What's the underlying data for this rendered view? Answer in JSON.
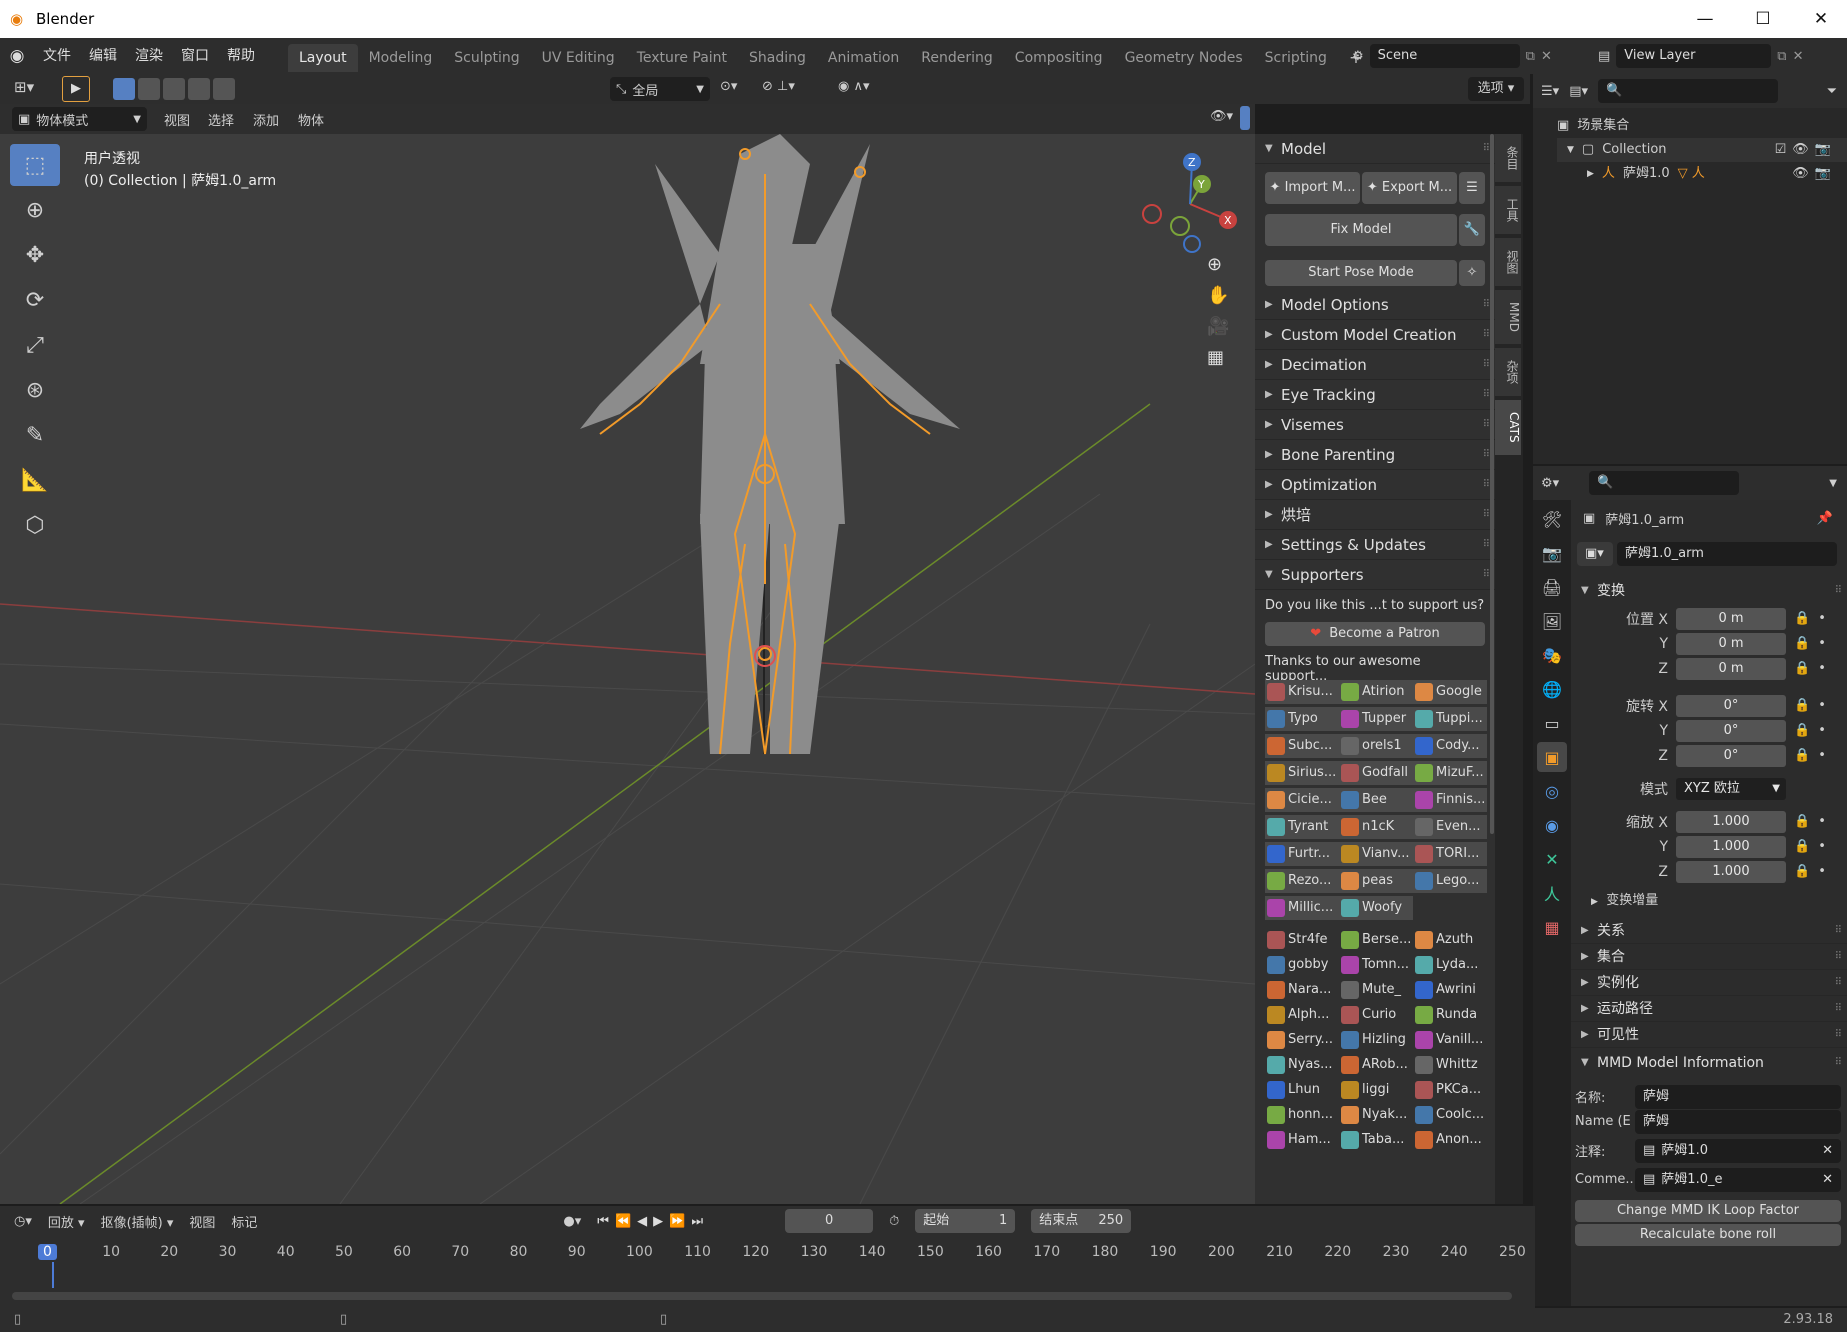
{
  "app": {
    "title": "Blender",
    "version": "2.93.18"
  },
  "menu": {
    "items": [
      "文件",
      "编辑",
      "渲染",
      "窗口",
      "帮助"
    ]
  },
  "workspaces": [
    "Layout",
    "Modeling",
    "Sculpting",
    "UV Editing",
    "Texture Paint",
    "Shading",
    "Animation",
    "Rendering",
    "Compositing",
    "Geometry Nodes",
    "Scripting"
  ],
  "active_workspace": "Layout",
  "scene": {
    "name": "Scene",
    "view_layer": "View Layer"
  },
  "viewport_header": {
    "transform_orientation": "全局",
    "options_label": "选项",
    "mode": "物体模式",
    "menus": [
      "视图",
      "选择",
      "添加",
      "物体"
    ]
  },
  "viewport": {
    "view_name": "用户透视",
    "collection_info": "(0) Collection | 萨姆1.0_arm",
    "gizmo_axes": [
      "X",
      "Y",
      "Z"
    ]
  },
  "cats_panel": {
    "header": "Model",
    "import_label": "Import M...",
    "export_label": "Export M...",
    "fix_label": "Fix Model",
    "pose_label": "Start Pose Mode",
    "sections": [
      "Model Options",
      "Custom Model Creation",
      "Decimation",
      "Eye Tracking",
      "Visemes",
      "Bone Parenting",
      "Optimization",
      "烘培",
      "Settings & Updates"
    ],
    "supporters_header": "Supporters",
    "support_text": "Do you like this ...t to support us?",
    "patron_label": "Become a Patron",
    "thanks_text": "Thanks to our awesome support...",
    "supporters_a": [
      "Krisu...",
      "Atirion",
      "Google",
      "Typo",
      "Tupper",
      "Tuppi...",
      "Subc...",
      "orels1",
      "Cody...",
      "Sirius...",
      "Godfall",
      "MizuF...",
      "Cicie...",
      "Bee",
      "Finnis...",
      "Tyrant",
      "n1cK",
      "Even...",
      "Furtr...",
      "Vianv...",
      "TORI...",
      "Rezo...",
      "peas",
      "Lego...",
      "Millic...",
      "Woofy"
    ],
    "supporters_b": [
      "Str4fe",
      "Berse...",
      "Azuth",
      "gobby",
      "Tomn...",
      "Lyda...",
      "Nara...",
      "Mute_",
      "Awrini",
      "Alph...",
      "Curio",
      "Runda",
      "Serry...",
      "Hizling",
      "Vanill...",
      "Nyas...",
      "ARob...",
      "Whittz",
      "Lhun",
      "liggi",
      "PKCa...",
      "honn...",
      "Nyak...",
      "Coolc...",
      "Ham...",
      "Taba...",
      "Anon..."
    ]
  },
  "vertical_tabs": [
    "条目",
    "工具",
    "视图",
    "MMD",
    "杂项",
    "CATS"
  ],
  "active_vtab": "CATS",
  "outliner": {
    "root": "场景集合",
    "collection": "Collection",
    "object": "萨姆1.0"
  },
  "properties": {
    "object_name": "萨姆1.0_arm",
    "data_name": "萨姆1.0_arm",
    "transform_header": "变换",
    "location_label": "位置 X",
    "rotation_label": "旋转 X",
    "scale_label": "缩放 X",
    "axis_y": "Y",
    "axis_z": "Z",
    "location": [
      "0 m",
      "0 m",
      "0 m"
    ],
    "rotation": [
      "0°",
      "0°",
      "0°"
    ],
    "mode_label": "模式",
    "rotation_mode": "XYZ 欧拉",
    "scale": [
      "1.000",
      "1.000",
      "1.000"
    ],
    "delta_transform": "变换增量",
    "collapsed": [
      "关系",
      "集合",
      "实例化",
      "运动路径",
      "可见性"
    ],
    "mmd_header": "MMD Model Information",
    "name_label": "名称:",
    "name_value": "萨姆",
    "name_e_label": "Name (E",
    "name_e_value": "萨姆",
    "comment_label": "注释:",
    "comment_value": "萨姆1.0",
    "comment_e_label": "Comme...",
    "comment_e_value": "萨姆1.0_e",
    "ik_button": "Change MMD IK Loop Factor",
    "roll_button": "Recalculate bone roll"
  },
  "timeline": {
    "playback": "回放",
    "keying": "抠像(插帧)",
    "view": "视图",
    "marker": "标记",
    "current_frame": "0",
    "start_label": "起始",
    "start": "1",
    "end_label": "结束点",
    "end": "250",
    "ticks": [
      "0",
      "10",
      "20",
      "30",
      "40",
      "50",
      "60",
      "70",
      "80",
      "90",
      "100",
      "110",
      "120",
      "130",
      "140",
      "150",
      "160",
      "170",
      "180",
      "190",
      "200",
      "210",
      "220",
      "230",
      "240",
      "250"
    ]
  },
  "colors": {
    "accent": "#5680c2",
    "armature": "#f29b2a",
    "mesh": "#8c8c8c",
    "x_axis": "#c8423f",
    "y_axis": "#7ba43a",
    "z_axis": "#3f74c8"
  }
}
